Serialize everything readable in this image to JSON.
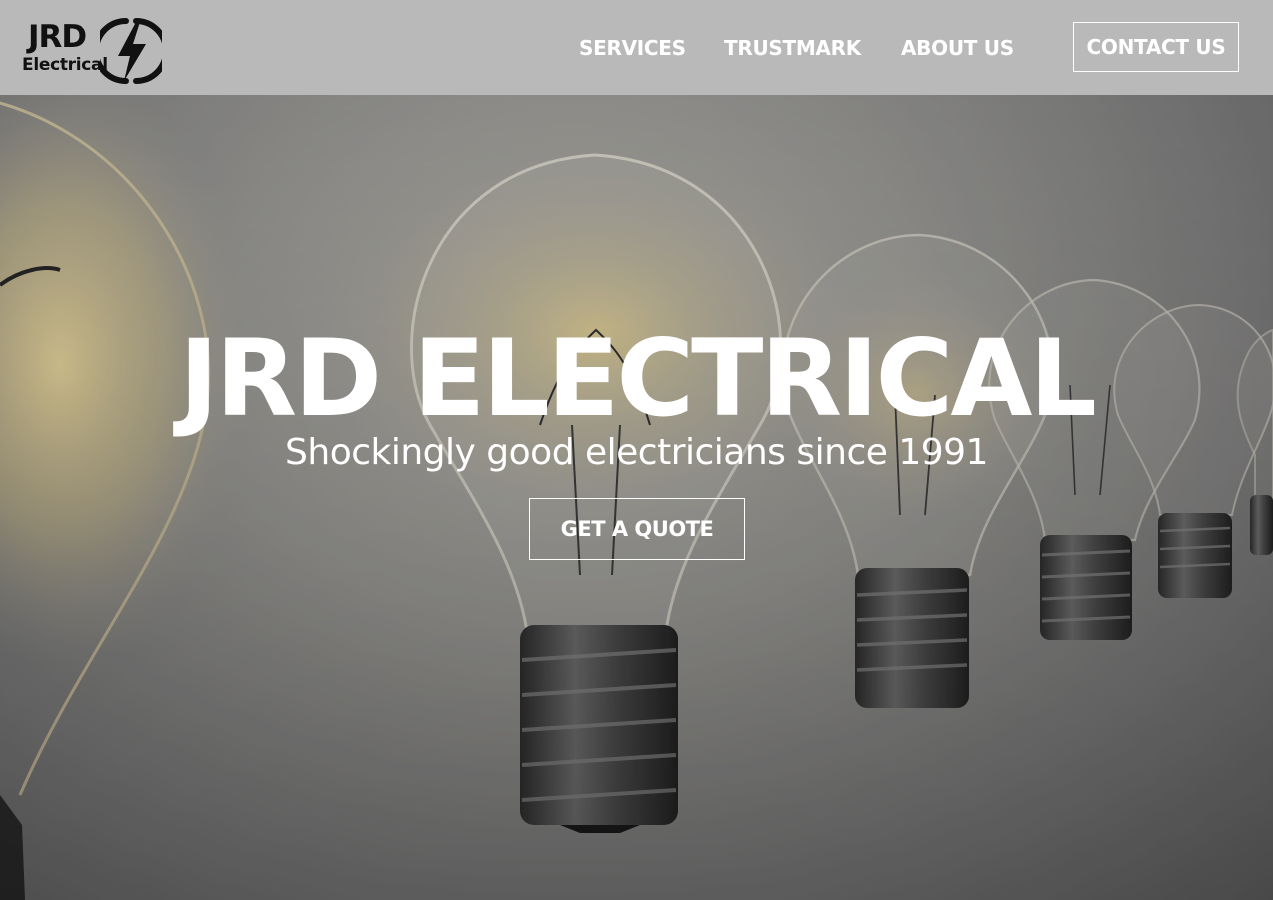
{
  "header": {
    "logo": {
      "title": "JRD",
      "subtitle": "Electrical",
      "icon": "lightning-bolt-icon"
    },
    "nav": {
      "services": "SERVICES",
      "trustmark": "TRUSTMARK",
      "about": "ABOUT US"
    },
    "contact_label": "CONTACT US"
  },
  "hero": {
    "title": "JRD ELECTRICAL",
    "tagline": "Shockingly good electricians since 1991",
    "cta_label": "GET A QUOTE",
    "background": "light-bulbs-photo"
  },
  "colors": {
    "header_bg": "#b9b9b9",
    "text_light": "#ffffff",
    "logo_dark": "#111111",
    "bulb_glow": "#f0d890"
  }
}
